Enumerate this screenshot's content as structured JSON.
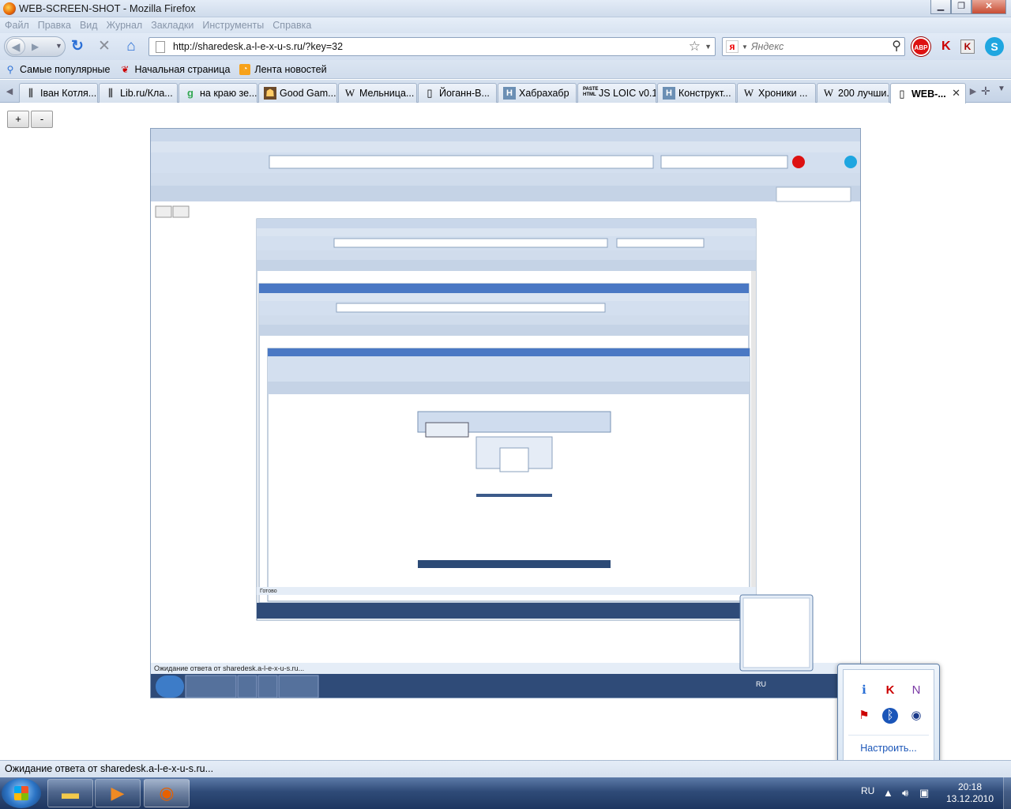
{
  "window": {
    "title": "WEB-SCREEN-SHOT - Mozilla Firefox"
  },
  "menu": [
    "Файл",
    "Правка",
    "Вид",
    "Журнал",
    "Закладки",
    "Инструменты",
    "Справка"
  ],
  "nav": {
    "url": "http://sharedesk.a-l-e-x-u-s.ru/?key=32",
    "search_placeholder": "Яндекс",
    "abp_label": "ABP"
  },
  "bookmarks": [
    {
      "label": "Самые популярные",
      "icon": "smart-bookmarks-icon"
    },
    {
      "label": "Начальная страница",
      "icon": "red-dragon-icon"
    },
    {
      "label": "Лента новостей",
      "icon": "rss-feed-icon"
    }
  ],
  "tabs": [
    {
      "label": "Іван Котля...",
      "icon": "library-icon"
    },
    {
      "label": "Lib.ru/Кла...",
      "icon": "library-icon"
    },
    {
      "label": "на краю зе...",
      "icon": "google-icon"
    },
    {
      "label": "Good Gam...",
      "icon": "game-icon"
    },
    {
      "label": "Мельница...",
      "icon": "wikipedia-icon"
    },
    {
      "label": "Йоганн-В...",
      "icon": "page-icon"
    },
    {
      "label": "Хабрахабр",
      "icon": "habr-icon"
    },
    {
      "label": "JS LOIC v0.1",
      "icon": "pastehtml-icon"
    },
    {
      "label": "Конструкт...",
      "icon": "habr-icon"
    },
    {
      "label": "Хроники ...",
      "icon": "wikipedia-icon"
    },
    {
      "label": "200 лучши...",
      "icon": "wikipedia-icon"
    },
    {
      "label": "WEB-...",
      "icon": "page-icon",
      "active": true
    }
  ],
  "page": {
    "zoom_in": "+",
    "zoom_out": "-",
    "nested_status": "Ожидание ответа от sharedesk.a-l-e-x-u-s.ru...",
    "nested_status_2": "Готово"
  },
  "tray_popup": {
    "configure_label": "Настроить...",
    "icons": [
      "network-info-icon",
      "kaspersky-icon",
      "onenote-icon",
      "flag-error-icon",
      "bluetooth-icon",
      "eye-icon"
    ]
  },
  "status": "Ожидание ответа от sharedesk.a-l-e-x-u-s.ru...",
  "taskbar": {
    "lang": "RU",
    "time": "20:18",
    "date": "13.12.2010",
    "apps": [
      "explorer-icon",
      "media-player-icon",
      "firefox-icon"
    ]
  }
}
